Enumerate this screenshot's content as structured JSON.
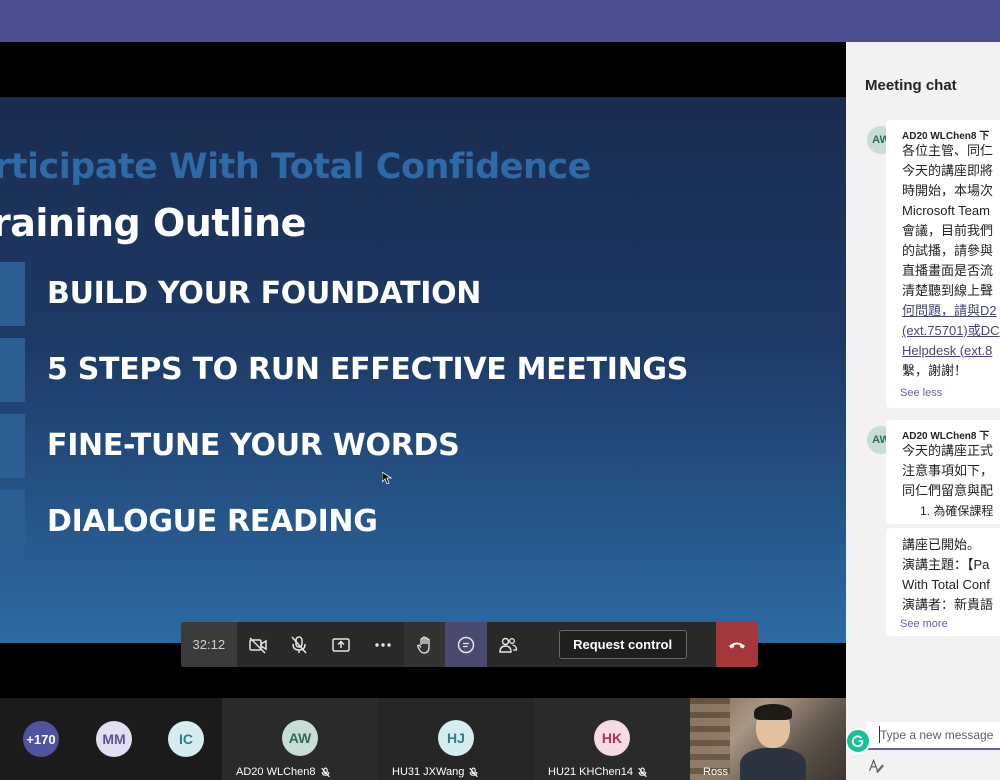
{
  "meeting": {
    "timer": "32:12",
    "request_control_label": "Request control"
  },
  "slide": {
    "subtitle": "rticipate With Total Confidence",
    "title": "raining Outline",
    "items": [
      {
        "num": "",
        "text": "BUILD YOUR FOUNDATION"
      },
      {
        "num": "",
        "text": "5 STEPS TO RUN EFFECTIVE MEETINGS"
      },
      {
        "num": "",
        "text": "FINE-TUNE YOUR WORDS"
      },
      {
        "num": "",
        "text": "DIALOGUE READING"
      }
    ]
  },
  "controls": [
    {
      "name": "camera-off-icon"
    },
    {
      "name": "mic-off-icon"
    },
    {
      "name": "share-screen-icon"
    },
    {
      "name": "more-options-icon"
    },
    {
      "name": "raise-hand-icon"
    },
    {
      "name": "chat-icon",
      "active": true
    },
    {
      "name": "participants-icon"
    }
  ],
  "gallery": {
    "overflow_count": "+170",
    "avatars": [
      {
        "initials": "MM"
      },
      {
        "initials": "IC"
      }
    ],
    "tiles": [
      {
        "initials": "AW",
        "label": "AD20 WLChen8"
      },
      {
        "initials": "HJ",
        "label": "HU31 JXWang"
      },
      {
        "initials": "HK",
        "label": "HU21 KHChen14"
      }
    ],
    "video_label": "Ross"
  },
  "chat": {
    "title": "Meeting chat",
    "messages": [
      {
        "avatar": "AW",
        "sender": "AD20 WLChen8   下",
        "lines": [
          "各位主管、同仁",
          "今天的講座即將",
          "時開始，本場次",
          "Microsoft Team",
          "會議，目前我們",
          "的試播，請參與",
          "直播畫面是否流",
          "清楚聽到線上聲",
          "何問題，請與D2",
          "(ext.75701)或DC",
          "Helpdesk (ext.8",
          "繫，謝謝！"
        ],
        "see_label": "See less"
      },
      {
        "avatar": "AW",
        "sender": "AD20 WLChen8   下",
        "lines": [
          "今天的講座正式",
          "注意事項如下，",
          "同仁們留意與配",
          "1. 為確保課程"
        ]
      },
      {
        "lines": [
          "講座已開始。",
          "演講主題：【Pa",
          "With Total Conf",
          "演講者：新貴語"
        ],
        "see_label": "See more"
      }
    ],
    "compose_placeholder": "Type a new message"
  },
  "colors": {
    "teams_purple": "#4b4f8f",
    "hangup_red": "#a4373a",
    "slide_blue": "#2d6aa3",
    "chat_bg": "#f3f2f1"
  }
}
